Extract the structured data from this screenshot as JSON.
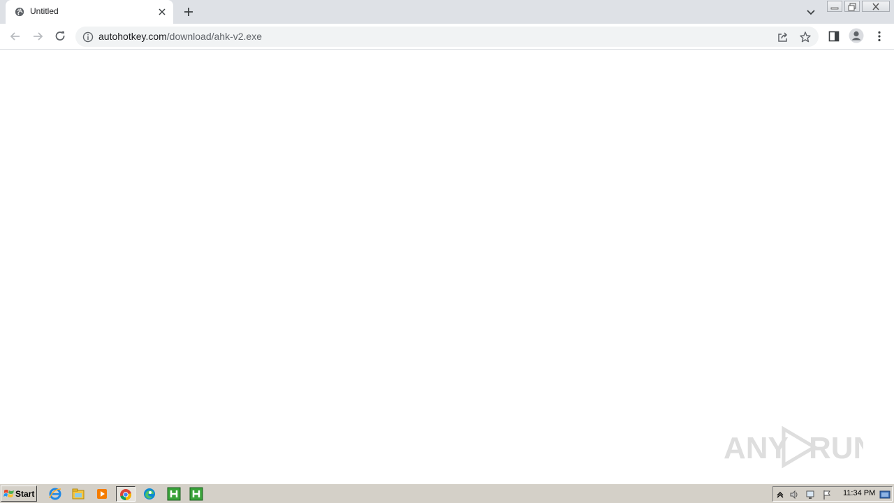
{
  "browser": {
    "tab": {
      "title": "Untitled",
      "favicon": "globe-icon"
    },
    "toolbar_icons": [
      "back-arrow-icon",
      "forward-arrow-icon",
      "reload-icon",
      "share-icon",
      "bookmark-star-icon",
      "side-panel-icon",
      "profile-avatar-icon",
      "more-menu-icon"
    ],
    "address": {
      "host": "autohotkey.com",
      "path": "/download/ahk-v2.exe"
    }
  },
  "watermark": {
    "text": "ANY RUN"
  },
  "taskbar": {
    "start_label": "Start",
    "apps": [
      "internet-explorer-icon",
      "file-explorer-icon",
      "media-player-icon",
      "chrome-icon",
      "edge-icon",
      "autohotkey-icon",
      "autohotkey-icon"
    ],
    "clock": "11:34 PM"
  },
  "colors": {
    "tabstrip": "#dee1e6",
    "omnibox": "#f1f3f4",
    "taskbar": "#d4d0c8",
    "icon": "#5f6368"
  }
}
